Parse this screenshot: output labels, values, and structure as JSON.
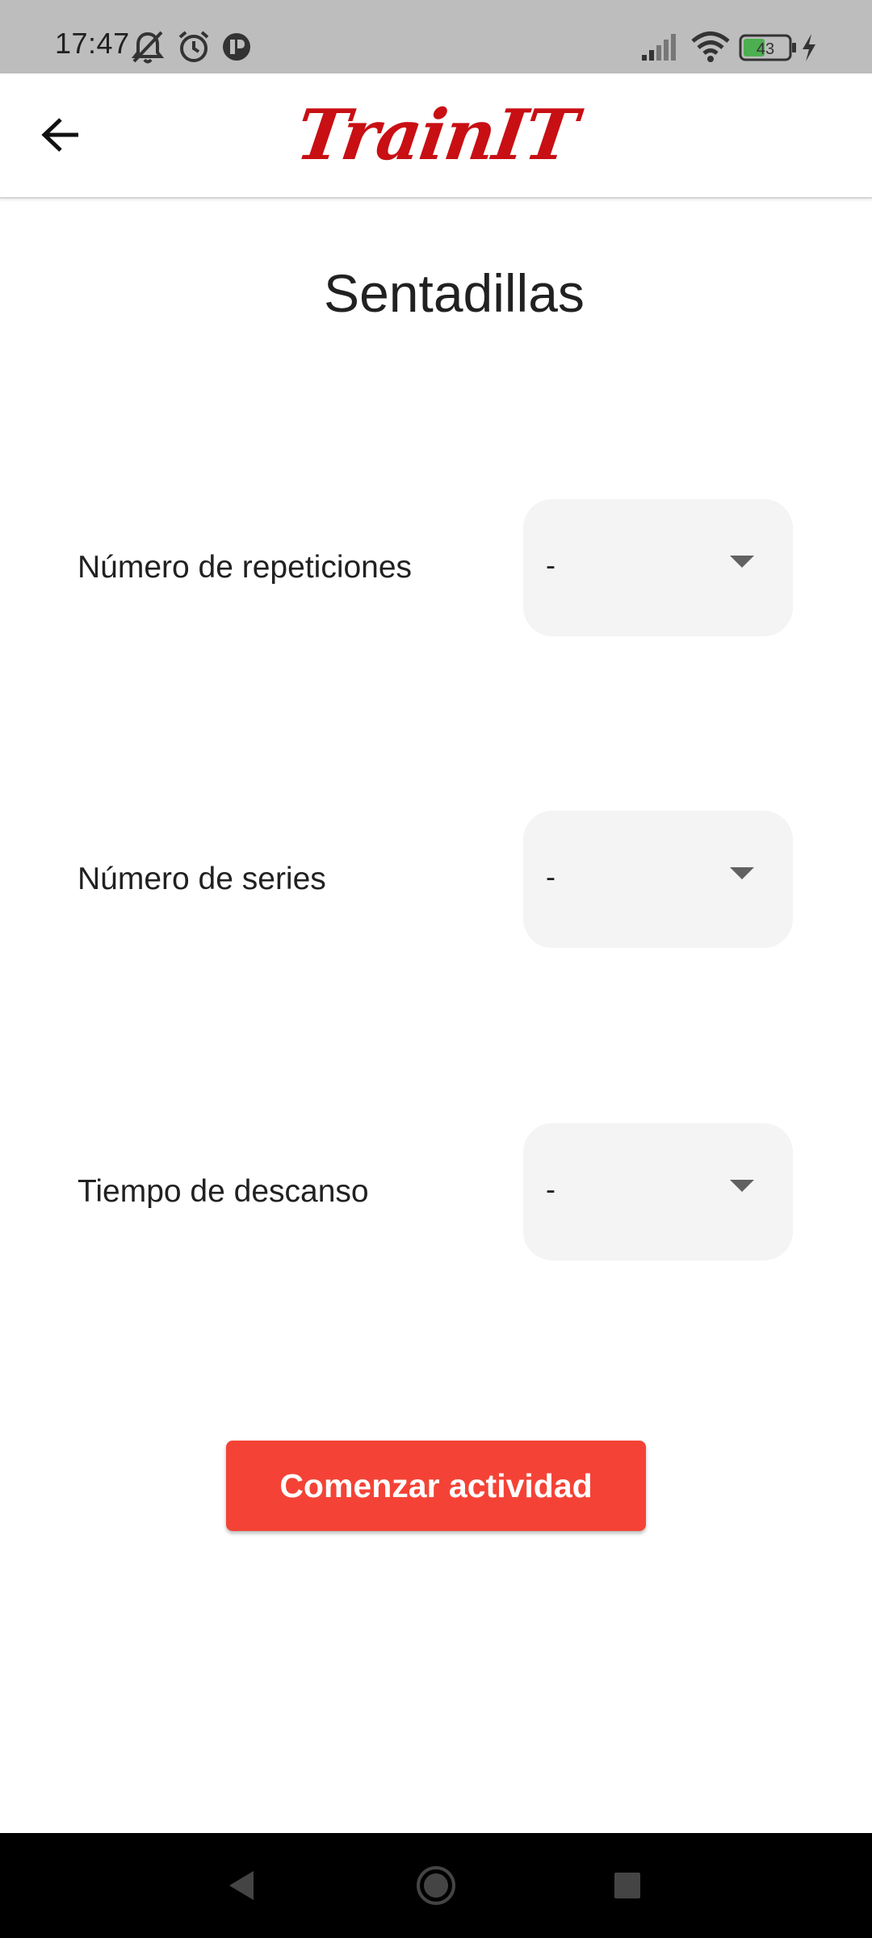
{
  "status_bar": {
    "time": "17:47",
    "battery_level": "43",
    "icons": [
      "mute-bell-icon",
      "alarm-icon",
      "app-notification-icon",
      "signal-icon",
      "wifi-icon",
      "battery-icon",
      "charging-icon"
    ]
  },
  "app_bar": {
    "back_icon": "arrow-back-icon",
    "logo_text": "TrainIT",
    "logo_color": "#c80f14"
  },
  "page": {
    "title": "Sentadillas"
  },
  "fields": [
    {
      "label": "Número de repeticiones",
      "value": "-"
    },
    {
      "label": "Número de series",
      "value": "-"
    },
    {
      "label": "Tiempo de descanso",
      "value": "-"
    }
  ],
  "actions": {
    "start_label": "Comenzar actividad",
    "start_color": "#f44336"
  },
  "nav_bar": {
    "items": [
      "nav-back-icon",
      "nav-home-icon",
      "nav-recents-icon"
    ]
  }
}
